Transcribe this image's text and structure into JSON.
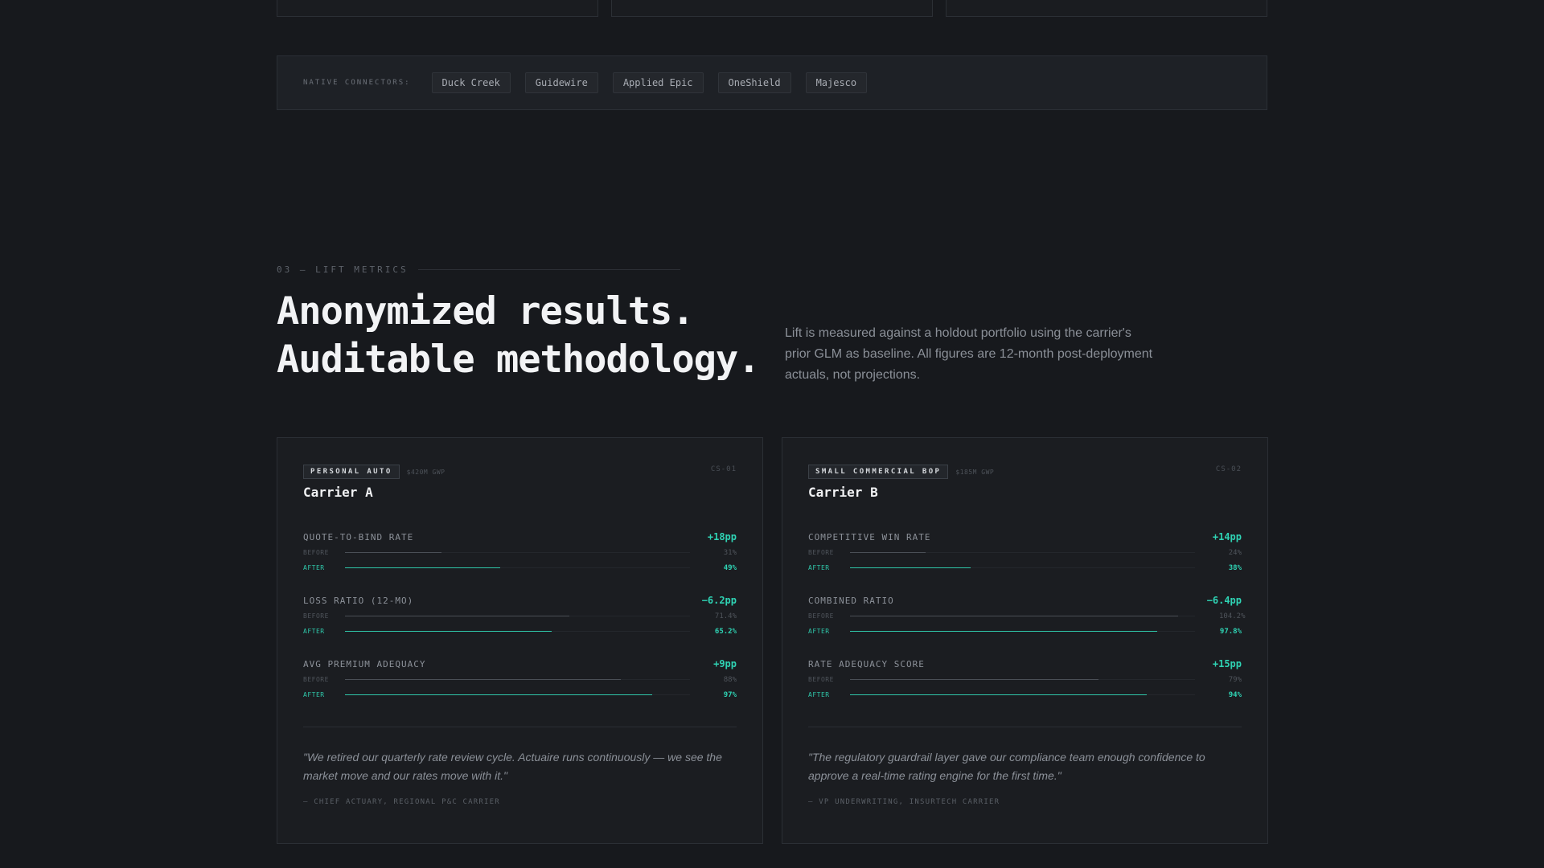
{
  "connectors": {
    "label": "NATIVE CONNECTORS:",
    "items": [
      "Duck Creek",
      "Guidewire",
      "Applied Epic",
      "OneShield",
      "Majesco"
    ]
  },
  "section": {
    "eyebrow": "03 — LIFT METRICS",
    "headline_line1": "Anonymized results.",
    "headline_line2": "Auditable methodology.",
    "lede": "Lift is measured against a holdout portfolio using the carrier's prior GLM as baseline. All figures are 12-month post-deployment actuals, not projections."
  },
  "cases": [
    {
      "segment": "PERSONAL AUTO",
      "gwp": "$420M GWP",
      "id": "CS-01",
      "carrier": "Carrier A",
      "metrics": [
        {
          "name": "QUOTE-TO-BIND RATE",
          "delta": "+18pp",
          "before_label": "BEFORE",
          "after_label": "AFTER",
          "before": "31%",
          "after": "49%",
          "before_fraction": 0.28,
          "after_fraction": 0.45
        },
        {
          "name": "LOSS RATIO (12-MO)",
          "delta": "−6.2pp",
          "before_label": "BEFORE",
          "after_label": "AFTER",
          "before": "71.4%",
          "after": "65.2%",
          "before_fraction": 0.65,
          "after_fraction": 0.6
        },
        {
          "name": "AVG PREMIUM ADEQUACY",
          "delta": "+9pp",
          "before_label": "BEFORE",
          "after_label": "AFTER",
          "before": "88%",
          "after": "97%",
          "before_fraction": 0.8,
          "after_fraction": 0.89
        }
      ],
      "quote": "\"We retired our quarterly rate review cycle. Actuaire runs continuously — we see the market move and our rates move with it.\"",
      "attribution": "— CHIEF ACTUARY, REGIONAL P&C CARRIER"
    },
    {
      "segment": "SMALL COMMERCIAL BOP",
      "gwp": "$185M GWP",
      "id": "CS-02",
      "carrier": "Carrier B",
      "metrics": [
        {
          "name": "COMPETITIVE WIN RATE",
          "delta": "+14pp",
          "before_label": "BEFORE",
          "after_label": "AFTER",
          "before": "24%",
          "after": "38%",
          "before_fraction": 0.22,
          "after_fraction": 0.35
        },
        {
          "name": "COMBINED RATIO",
          "delta": "−6.4pp",
          "before_label": "BEFORE",
          "after_label": "AFTER",
          "before": "104.2%",
          "after": "97.8%",
          "before_fraction": 0.95,
          "after_fraction": 0.89
        },
        {
          "name": "RATE ADEQUACY SCORE",
          "delta": "+15pp",
          "before_label": "BEFORE",
          "after_label": "AFTER",
          "before": "79%",
          "after": "94%",
          "before_fraction": 0.72,
          "after_fraction": 0.86
        }
      ],
      "quote": "\"The regulatory guardrail layer gave our compliance team enough confidence to approve a real-time rating engine for the first time.\"",
      "attribution": "— VP UNDERWRITING, INSURTECH CARRIER"
    }
  ]
}
